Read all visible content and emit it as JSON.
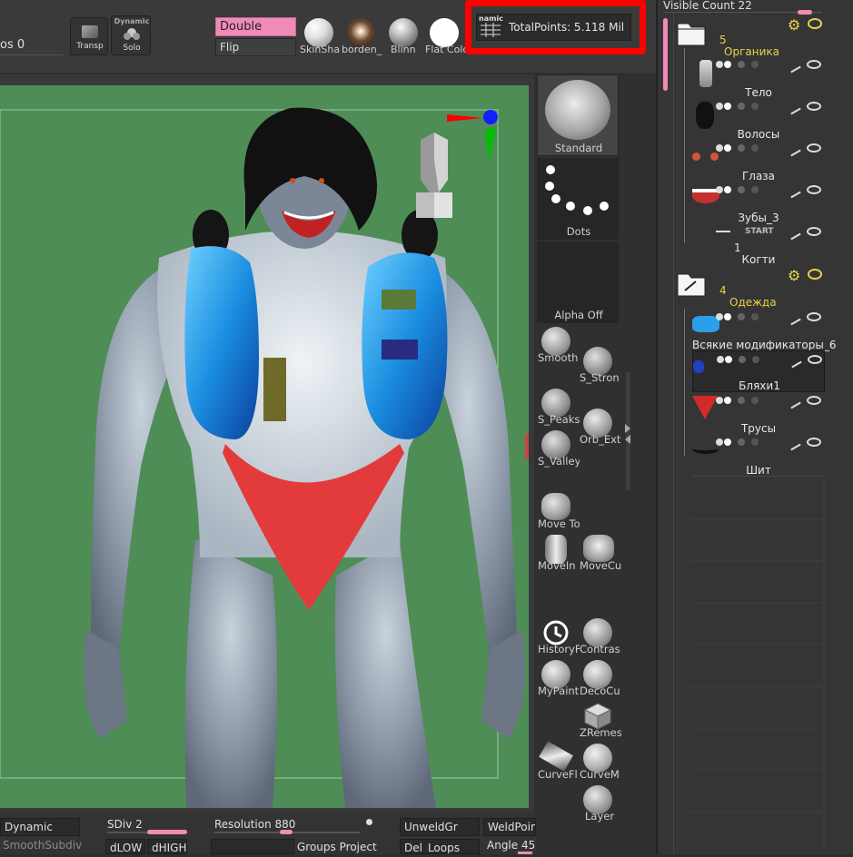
{
  "topbar": {
    "steps_label": "os",
    "steps_value": "0",
    "transp_label": "Transp",
    "solo_top_label": "Dynamic",
    "solo_label": "Solo",
    "double_label": "Double",
    "flip_label": "Flip",
    "materials": [
      {
        "label": "SkinSha",
        "color": "#e9e9e9"
      },
      {
        "label": "borden_",
        "color": "#caa78a"
      },
      {
        "label": "Blinn",
        "color": "#cfcfcf"
      },
      {
        "label": "Flat Colo",
        "color": "#ffffff"
      }
    ],
    "dynamic_small": "namic",
    "total_points": "TotalPoints: 5.118 Mil",
    "highlight_color": "#ff0000"
  },
  "brushes": {
    "standard_label": "Standard",
    "dots_label": "Dots",
    "alpha_label": "Alpha Off",
    "tools": [
      {
        "id": "smooth",
        "label": "Smooth"
      },
      {
        "id": "s-strong",
        "label": "S_Stron"
      },
      {
        "id": "s-peaks",
        "label": "S_Peaks"
      },
      {
        "id": "orb-ext",
        "label": "Orb_Ext"
      },
      {
        "id": "s-valley",
        "label": "S_Valley"
      },
      {
        "id": "move-topo",
        "label": "Move To"
      },
      {
        "id": "move-inf",
        "label": "MoveIn"
      },
      {
        "id": "move-curve",
        "label": "MoveCu"
      },
      {
        "id": "history",
        "label": "HistoryF"
      },
      {
        "id": "contrast",
        "label": "Contras"
      },
      {
        "id": "mypaint",
        "label": "MyPaint"
      },
      {
        "id": "decocurve",
        "label": "DecoCu"
      },
      {
        "id": "zremesh",
        "label": "ZRemes"
      },
      {
        "id": "curvefl",
        "label": "CurveFl"
      },
      {
        "id": "curvem",
        "label": "CurveM"
      },
      {
        "id": "layer",
        "label": "Layer"
      }
    ]
  },
  "bottombar": {
    "dynamic_label": "Dynamic",
    "smoothsubdiv_label": "SmoothSubdiv",
    "sdiv_label": "SDiv",
    "sdiv_value": "2",
    "dlow_label": "dLOW",
    "dhigh_label": "dHIGH",
    "resolution_label": "Resolution",
    "resolution_value": "880",
    "groups_label": "Groups",
    "project_label": "Project",
    "unweldgr_label": "UnweldGr",
    "weldpoint_label": "WeldPoin",
    "delloops_label": "Del_Loops",
    "angle_label": "Angle",
    "angle_value": "45"
  },
  "subtools": {
    "visible_count": "Visible Count 22",
    "folders": [
      {
        "number": "5",
        "name": "Органика",
        "items": [
          "Тело",
          "Волосы",
          "Глаза",
          "Зубы_3",
          "Когти"
        ]
      },
      {
        "number": "4",
        "name": "Одежда",
        "items": [
          "Всякие модификаторы_6",
          "Бляхи1",
          "Трусы",
          "Шит"
        ]
      }
    ],
    "start_label": "START",
    "start_number": "1"
  }
}
